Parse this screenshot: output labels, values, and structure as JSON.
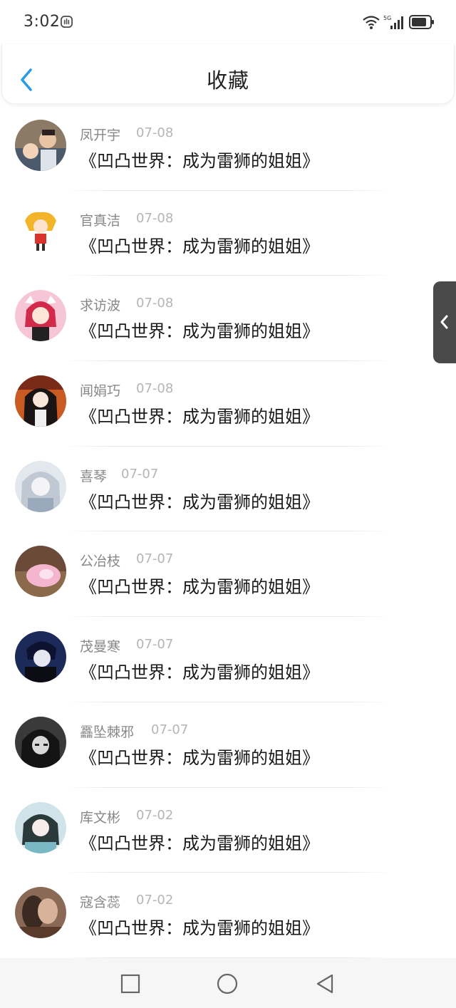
{
  "status_bar": {
    "time": "3:02",
    "network": "5G",
    "icons": [
      "app-notification-icon",
      "wifi-icon",
      "signal-icon",
      "battery-icon"
    ]
  },
  "header": {
    "title": "收藏",
    "back_icon": "chevron-left-icon"
  },
  "colors": {
    "accent": "#2b9be8",
    "title_text": "#1a1a1a",
    "name_text": "#888888",
    "date_text": "#b5b5b5"
  },
  "favorites": [
    {
      "name": "凤开宇",
      "date": "07-08",
      "title": "《凹凸世界：成为雷狮的姐姐》"
    },
    {
      "name": "官真洁",
      "date": "07-08",
      "title": "《凹凸世界：成为雷狮的姐姐》"
    },
    {
      "name": "求访波",
      "date": "07-08",
      "title": "《凹凸世界：成为雷狮的姐姐》"
    },
    {
      "name": "闻娟巧",
      "date": "07-08",
      "title": "《凹凸世界：成为雷狮的姐姐》"
    },
    {
      "name": "喜琴",
      "date": "07-07",
      "title": "《凹凸世界：成为雷狮的姐姐》"
    },
    {
      "name": "公冶枝",
      "date": "07-07",
      "title": "《凹凸世界：成为雷狮的姐姐》"
    },
    {
      "name": "茂曼寒",
      "date": "07-07",
      "title": "《凹凸世界：成为雷狮的姐姐》"
    },
    {
      "name": "靐坠棘邪",
      "date": "07-07",
      "title": "《凹凸世界：成为雷狮的姐姐》"
    },
    {
      "name": "库文彬",
      "date": "07-02",
      "title": "《凹凸世界：成为雷狮的姐姐》"
    },
    {
      "name": "寇含蕊",
      "date": "07-02",
      "title": "《凹凸世界：成为雷狮的姐姐》"
    }
  ],
  "side_handle": {
    "icon": "chevron-left-icon"
  },
  "nav_bar": {
    "buttons": [
      "recents-square-icon",
      "home-circle-icon",
      "back-triangle-icon"
    ]
  }
}
